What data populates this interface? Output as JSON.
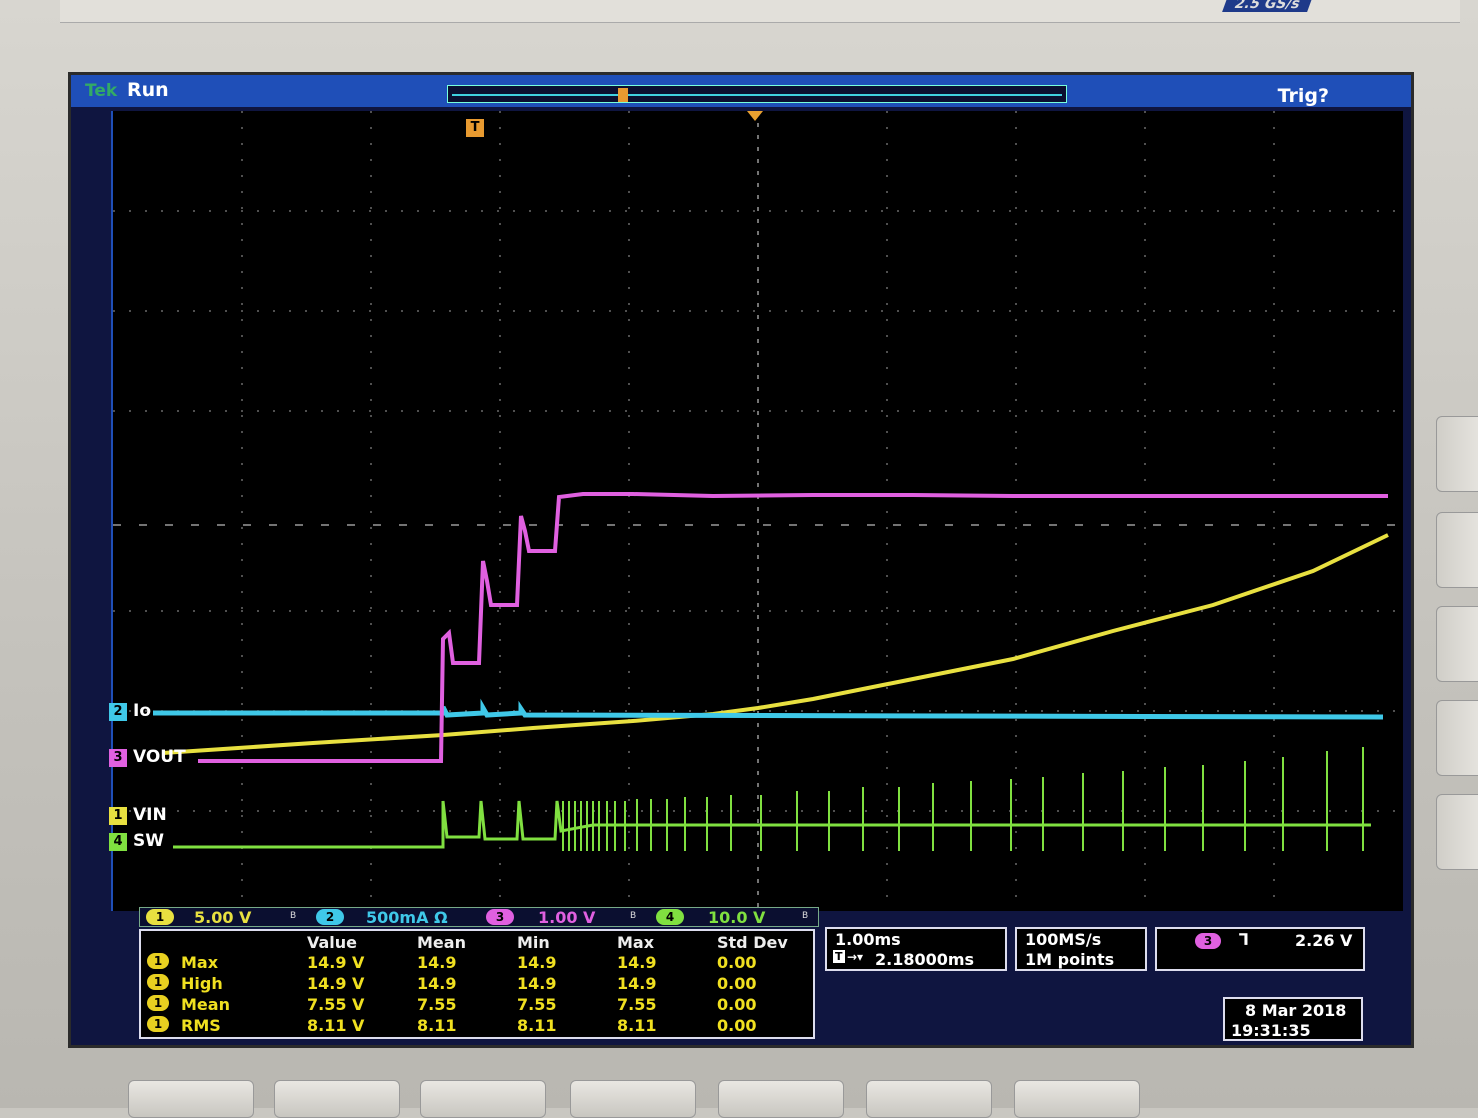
{
  "header": {
    "brand": "Tek",
    "run_state": "Run",
    "trigger_state": "Trig?",
    "sample_rate_strip": "2.5 GS/s"
  },
  "markers": {
    "trigger_position": "T"
  },
  "channels": [
    {
      "num": "2",
      "label": "Io",
      "color": "#3fc8e8"
    },
    {
      "num": "3",
      "label": "VOUT",
      "color": "#e060e0"
    },
    {
      "num": "1",
      "label": "VIN",
      "color": "#e8e040"
    },
    {
      "num": "4",
      "label": "SW",
      "color": "#80e040"
    }
  ],
  "scales": [
    {
      "num": "1",
      "value": "5.00 V",
      "color": "#e8e040"
    },
    {
      "num": "2",
      "value": "500mA Ω",
      "color": "#3fc8e8"
    },
    {
      "num": "3",
      "value": "1.00 V",
      "color": "#e060e0"
    },
    {
      "num": "4",
      "value": "10.0 V",
      "color": "#80e040"
    }
  ],
  "measurements": {
    "headers": [
      "Value",
      "Mean",
      "Min",
      "Max",
      "Std Dev"
    ],
    "rows": [
      {
        "ch": "1",
        "name": "Max",
        "value": "14.9 V",
        "mean": "14.9",
        "min": "14.9",
        "max": "14.9",
        "std": "0.00"
      },
      {
        "ch": "1",
        "name": "High",
        "value": "14.9 V",
        "mean": "14.9",
        "min": "14.9",
        "max": "14.9",
        "std": "0.00"
      },
      {
        "ch": "1",
        "name": "Mean",
        "value": "7.55 V",
        "mean": "7.55",
        "min": "7.55",
        "max": "7.55",
        "std": "0.00"
      },
      {
        "ch": "1",
        "name": "RMS",
        "value": "8.11 V",
        "mean": "8.11",
        "min": "8.11",
        "max": "8.11",
        "std": "0.00"
      }
    ]
  },
  "timebase": {
    "scale": "1.00ms",
    "delay": "2.18000ms"
  },
  "acquisition": {
    "rate": "100MS/s",
    "points": "1M points"
  },
  "trigger": {
    "source": "3",
    "level": "2.26 V"
  },
  "datetime": {
    "date": "8 Mar 2018",
    "time": "19:31:35"
  }
}
